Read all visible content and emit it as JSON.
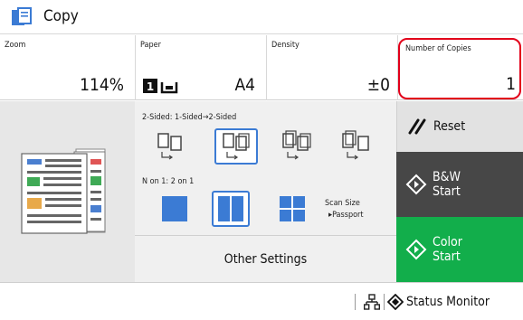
{
  "window": {
    "title": "Copy",
    "icon": "copy-icon"
  },
  "settings": {
    "zoom": {
      "label": "Zoom",
      "value": "114%"
    },
    "paper": {
      "label": "Paper",
      "value": "A4",
      "icons": [
        "paper-drawer-icon",
        "paper-tray-icon"
      ]
    },
    "density": {
      "label": "Density",
      "value": "±0"
    },
    "copies": {
      "label": "Number of Copies",
      "value": "1"
    }
  },
  "preview": {
    "icon": "document-preview-icon"
  },
  "two_sided": {
    "label": "2-Sided: 1-Sided→2-Sided",
    "options": [
      {
        "icon": "one-to-one-sided-icon",
        "selected": false
      },
      {
        "icon": "one-to-two-sided-icon",
        "selected": true
      },
      {
        "icon": "two-to-two-sided-icon",
        "selected": false
      },
      {
        "icon": "two-to-one-sided-icon",
        "selected": false
      }
    ]
  },
  "n_on_1": {
    "label": "N on 1: 2 on 1",
    "options": [
      {
        "icon": "one-on-one-icon",
        "selected": false
      },
      {
        "icon": "two-on-one-icon",
        "selected": true
      },
      {
        "icon": "four-on-one-icon",
        "selected": false
      }
    ],
    "scan_size_label": "Scan Size",
    "scan_size_value": "▸Passport"
  },
  "other_settings_label": "Other Settings",
  "buttons": {
    "reset": "Reset",
    "bw_line1": "B&W",
    "bw_line2": "Start",
    "color_line1": "Color",
    "color_line2": "Start"
  },
  "status_bar": {
    "network_icon": "network-icon",
    "status_monitor_label": "Status Monitor"
  },
  "colors": {
    "accent_blue": "#3b7bd4",
    "highlight_red": "#e2001a",
    "bw_button": "#474747",
    "color_button": "#12ae4b"
  }
}
